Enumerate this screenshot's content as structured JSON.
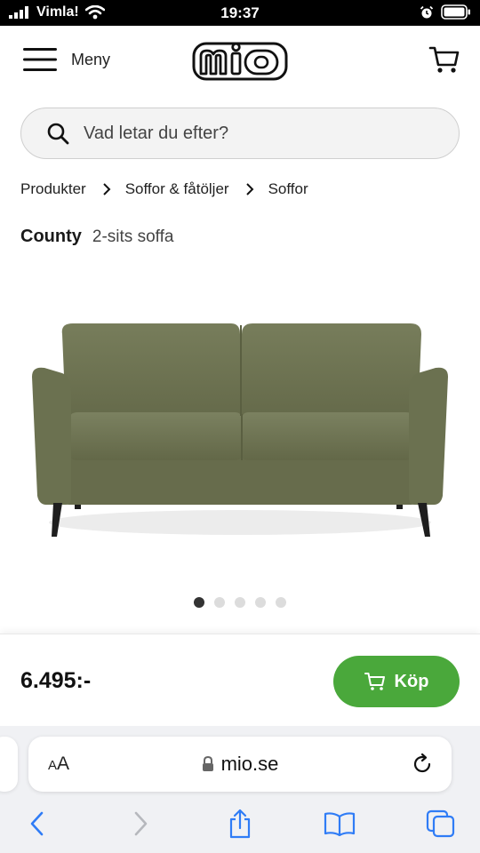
{
  "status_bar": {
    "carrier": "Vimla!",
    "time": "19:37"
  },
  "header": {
    "menu_label": "Meny",
    "logo_text": "mio"
  },
  "search": {
    "placeholder": "Vad letar du efter?"
  },
  "breadcrumb": [
    "Produkter",
    "Soffor & fåtöljer",
    "Soffor"
  ],
  "product": {
    "name": "County",
    "type": "2-sits soffa",
    "price": "6.495:-",
    "image_count": 5,
    "active_image": 1
  },
  "buy_button": {
    "label": "Köp"
  },
  "browser": {
    "text_size_label_small": "A",
    "text_size_label_large": "A",
    "url": "mio.se"
  },
  "colors": {
    "buy_green": "#4aa83b",
    "sofa_green": "#6e7452",
    "legs": "#1e1e1e",
    "ios_blue": "#2f7cf6"
  }
}
